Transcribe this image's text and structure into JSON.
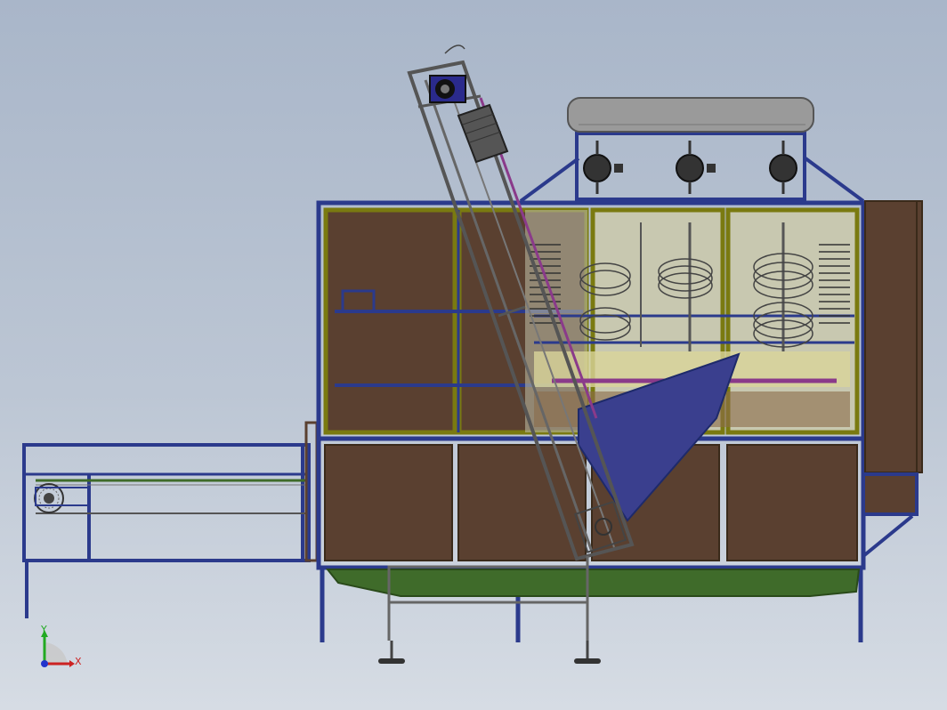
{
  "scene": {
    "colors": {
      "frame": "#2b3a8c",
      "frame_dark": "#1e2a6a",
      "panel_brown": "#5a4030",
      "panel_olive": "#7a7a10",
      "conveyor_gray": "#8a8a8a",
      "hopper_blue": "#3a3f8e",
      "base_green": "#3f6b2a",
      "tank_gray": "#9a9a9a",
      "belt_purple": "#8a3a8a"
    }
  },
  "triad": {
    "x_label": "X",
    "y_label": "Y",
    "x_color": "#cc2222",
    "y_color": "#22aa22",
    "z_color": "#2233cc"
  }
}
